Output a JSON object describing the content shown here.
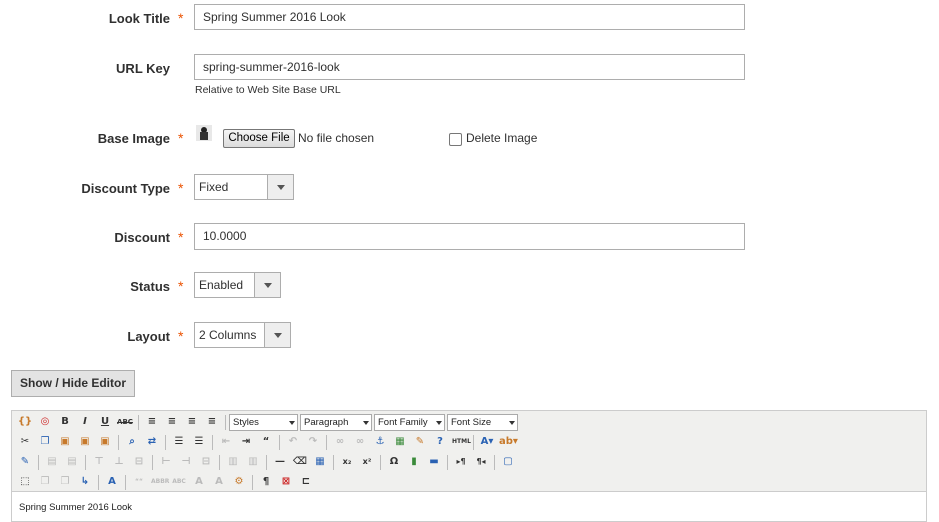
{
  "form": {
    "look_title": {
      "label": "Look Title",
      "value": "Spring Summer 2016 Look"
    },
    "url_key": {
      "label": "URL Key",
      "value": "spring-summer-2016-look",
      "note": "Relative to Web Site Base URL"
    },
    "base_image": {
      "label": "Base Image",
      "choose_label": "Choose File",
      "no_file": "No file chosen",
      "delete_label": "Delete Image"
    },
    "discount_type": {
      "label": "Discount Type",
      "value": "Fixed"
    },
    "discount": {
      "label": "Discount",
      "value": "10.0000"
    },
    "status": {
      "label": "Status",
      "value": "Enabled"
    },
    "layout": {
      "label": "Layout",
      "value": "2 Columns"
    },
    "required_mark": "*"
  },
  "editor": {
    "toggle_label": "Show / Hide Editor",
    "styles": "Styles",
    "format": "Paragraph",
    "font_family": "Font Family",
    "font_size": "Font Size",
    "content": "Spring Summer 2016 Look"
  }
}
